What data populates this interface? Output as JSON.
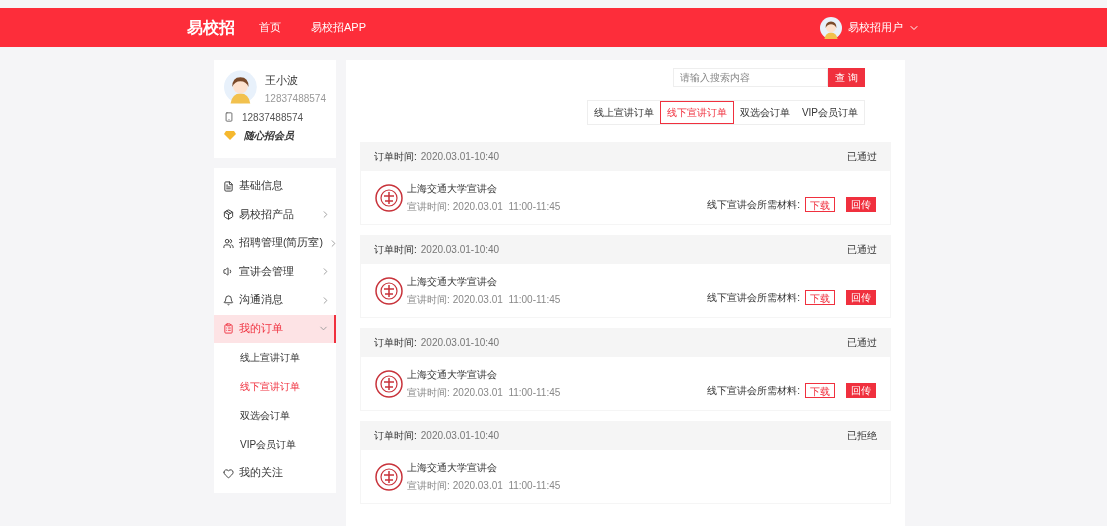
{
  "nav": {
    "logo": "易校招",
    "links": [
      "首页",
      "易校招APP"
    ],
    "user": "易校招用户"
  },
  "profile": {
    "name": "王小波",
    "id": "12837488574",
    "phone": "12837488574",
    "badge": "随心招会员"
  },
  "menu": [
    {
      "label": "基础信息",
      "arrow": false,
      "selected": false
    },
    {
      "label": "易校招产品",
      "arrow": true,
      "expanded": false,
      "selected": false
    },
    {
      "label": "招聘管理(简历室)",
      "arrow": true,
      "expanded": false,
      "selected": false
    },
    {
      "label": "宣讲会管理",
      "arrow": true,
      "expanded": false,
      "selected": false
    },
    {
      "label": "沟通消息",
      "arrow": true,
      "expanded": false,
      "selected": false
    },
    {
      "label": "我的订单",
      "arrow": true,
      "expanded": true,
      "selected": true,
      "children": [
        {
          "label": "线上宣讲订单",
          "selected": false
        },
        {
          "label": "线下宣讲订单",
          "selected": true
        },
        {
          "label": "双选会订单",
          "selected": false
        },
        {
          "label": "VIP会员订单",
          "selected": false
        }
      ]
    },
    {
      "label": "我的关注",
      "arrow": false,
      "selected": false
    }
  ],
  "search": {
    "placeholder": "请输入搜索内容",
    "button": "查 询"
  },
  "tabs": [
    {
      "label": "线上宣讲订单",
      "selected": false
    },
    {
      "label": "线下宣讲订单",
      "selected": true
    },
    {
      "label": "双选会订单",
      "selected": false
    },
    {
      "label": "VIP会员订单",
      "selected": false
    }
  ],
  "orders": [
    {
      "time_label": "订单时间:",
      "time": "2020.03.01-10:40",
      "status": "已通过",
      "title": "上海交通大学宣讲会",
      "date_label": "宣讲时间:",
      "date": "2020.03.01  11:00-11:45",
      "materials": {
        "label": "线下宣讲会所需材料:",
        "download": "下载",
        "upload": "回传"
      }
    },
    {
      "time_label": "订单时间:",
      "time": "2020.03.01-10:40",
      "status": "已通过",
      "title": "上海交通大学宣讲会",
      "date_label": "宣讲时间:",
      "date": "2020.03.01  11:00-11:45",
      "materials": {
        "label": "线下宣讲会所需材料:",
        "download": "下载",
        "upload": "回传"
      }
    },
    {
      "time_label": "订单时间:",
      "time": "2020.03.01-10:40",
      "status": "已通过",
      "title": "上海交通大学宣讲会",
      "date_label": "宣讲时间:",
      "date": "2020.03.01  11:00-11:45",
      "materials": {
        "label": "线下宣讲会所需材料:",
        "download": "下载",
        "upload": "回传"
      }
    },
    {
      "time_label": "订单时间:",
      "time": "2020.03.01-10:40",
      "status": "已拒绝",
      "title": "上海交通大学宣讲会",
      "date_label": "宣讲时间:",
      "date": "2020.03.01  11:00-11:45"
    }
  ]
}
